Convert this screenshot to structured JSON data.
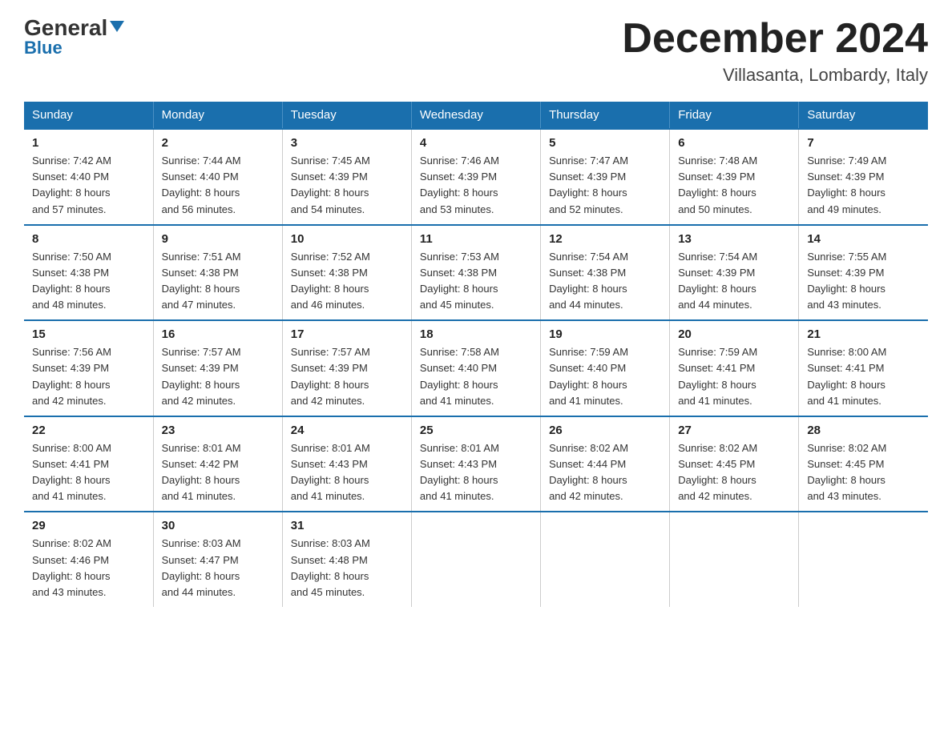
{
  "header": {
    "logo_general": "General",
    "logo_blue": "Blue",
    "title": "December 2024",
    "subtitle": "Villasanta, Lombardy, Italy"
  },
  "days_of_week": [
    "Sunday",
    "Monday",
    "Tuesday",
    "Wednesday",
    "Thursday",
    "Friday",
    "Saturday"
  ],
  "weeks": [
    [
      {
        "day": "1",
        "sunrise": "7:42 AM",
        "sunset": "4:40 PM",
        "daylight": "8 hours and 57 minutes."
      },
      {
        "day": "2",
        "sunrise": "7:44 AM",
        "sunset": "4:40 PM",
        "daylight": "8 hours and 56 minutes."
      },
      {
        "day": "3",
        "sunrise": "7:45 AM",
        "sunset": "4:39 PM",
        "daylight": "8 hours and 54 minutes."
      },
      {
        "day": "4",
        "sunrise": "7:46 AM",
        "sunset": "4:39 PM",
        "daylight": "8 hours and 53 minutes."
      },
      {
        "day": "5",
        "sunrise": "7:47 AM",
        "sunset": "4:39 PM",
        "daylight": "8 hours and 52 minutes."
      },
      {
        "day": "6",
        "sunrise": "7:48 AM",
        "sunset": "4:39 PM",
        "daylight": "8 hours and 50 minutes."
      },
      {
        "day": "7",
        "sunrise": "7:49 AM",
        "sunset": "4:39 PM",
        "daylight": "8 hours and 49 minutes."
      }
    ],
    [
      {
        "day": "8",
        "sunrise": "7:50 AM",
        "sunset": "4:38 PM",
        "daylight": "8 hours and 48 minutes."
      },
      {
        "day": "9",
        "sunrise": "7:51 AM",
        "sunset": "4:38 PM",
        "daylight": "8 hours and 47 minutes."
      },
      {
        "day": "10",
        "sunrise": "7:52 AM",
        "sunset": "4:38 PM",
        "daylight": "8 hours and 46 minutes."
      },
      {
        "day": "11",
        "sunrise": "7:53 AM",
        "sunset": "4:38 PM",
        "daylight": "8 hours and 45 minutes."
      },
      {
        "day": "12",
        "sunrise": "7:54 AM",
        "sunset": "4:38 PM",
        "daylight": "8 hours and 44 minutes."
      },
      {
        "day": "13",
        "sunrise": "7:54 AM",
        "sunset": "4:39 PM",
        "daylight": "8 hours and 44 minutes."
      },
      {
        "day": "14",
        "sunrise": "7:55 AM",
        "sunset": "4:39 PM",
        "daylight": "8 hours and 43 minutes."
      }
    ],
    [
      {
        "day": "15",
        "sunrise": "7:56 AM",
        "sunset": "4:39 PM",
        "daylight": "8 hours and 42 minutes."
      },
      {
        "day": "16",
        "sunrise": "7:57 AM",
        "sunset": "4:39 PM",
        "daylight": "8 hours and 42 minutes."
      },
      {
        "day": "17",
        "sunrise": "7:57 AM",
        "sunset": "4:39 PM",
        "daylight": "8 hours and 42 minutes."
      },
      {
        "day": "18",
        "sunrise": "7:58 AM",
        "sunset": "4:40 PM",
        "daylight": "8 hours and 41 minutes."
      },
      {
        "day": "19",
        "sunrise": "7:59 AM",
        "sunset": "4:40 PM",
        "daylight": "8 hours and 41 minutes."
      },
      {
        "day": "20",
        "sunrise": "7:59 AM",
        "sunset": "4:41 PM",
        "daylight": "8 hours and 41 minutes."
      },
      {
        "day": "21",
        "sunrise": "8:00 AM",
        "sunset": "4:41 PM",
        "daylight": "8 hours and 41 minutes."
      }
    ],
    [
      {
        "day": "22",
        "sunrise": "8:00 AM",
        "sunset": "4:41 PM",
        "daylight": "8 hours and 41 minutes."
      },
      {
        "day": "23",
        "sunrise": "8:01 AM",
        "sunset": "4:42 PM",
        "daylight": "8 hours and 41 minutes."
      },
      {
        "day": "24",
        "sunrise": "8:01 AM",
        "sunset": "4:43 PM",
        "daylight": "8 hours and 41 minutes."
      },
      {
        "day": "25",
        "sunrise": "8:01 AM",
        "sunset": "4:43 PM",
        "daylight": "8 hours and 41 minutes."
      },
      {
        "day": "26",
        "sunrise": "8:02 AM",
        "sunset": "4:44 PM",
        "daylight": "8 hours and 42 minutes."
      },
      {
        "day": "27",
        "sunrise": "8:02 AM",
        "sunset": "4:45 PM",
        "daylight": "8 hours and 42 minutes."
      },
      {
        "day": "28",
        "sunrise": "8:02 AM",
        "sunset": "4:45 PM",
        "daylight": "8 hours and 43 minutes."
      }
    ],
    [
      {
        "day": "29",
        "sunrise": "8:02 AM",
        "sunset": "4:46 PM",
        "daylight": "8 hours and 43 minutes."
      },
      {
        "day": "30",
        "sunrise": "8:03 AM",
        "sunset": "4:47 PM",
        "daylight": "8 hours and 44 minutes."
      },
      {
        "day": "31",
        "sunrise": "8:03 AM",
        "sunset": "4:48 PM",
        "daylight": "8 hours and 45 minutes."
      },
      {
        "day": "",
        "sunrise": "",
        "sunset": "",
        "daylight": ""
      },
      {
        "day": "",
        "sunrise": "",
        "sunset": "",
        "daylight": ""
      },
      {
        "day": "",
        "sunrise": "",
        "sunset": "",
        "daylight": ""
      },
      {
        "day": "",
        "sunrise": "",
        "sunset": "",
        "daylight": ""
      }
    ]
  ],
  "labels": {
    "sunrise": "Sunrise:",
    "sunset": "Sunset:",
    "daylight": "Daylight:"
  }
}
